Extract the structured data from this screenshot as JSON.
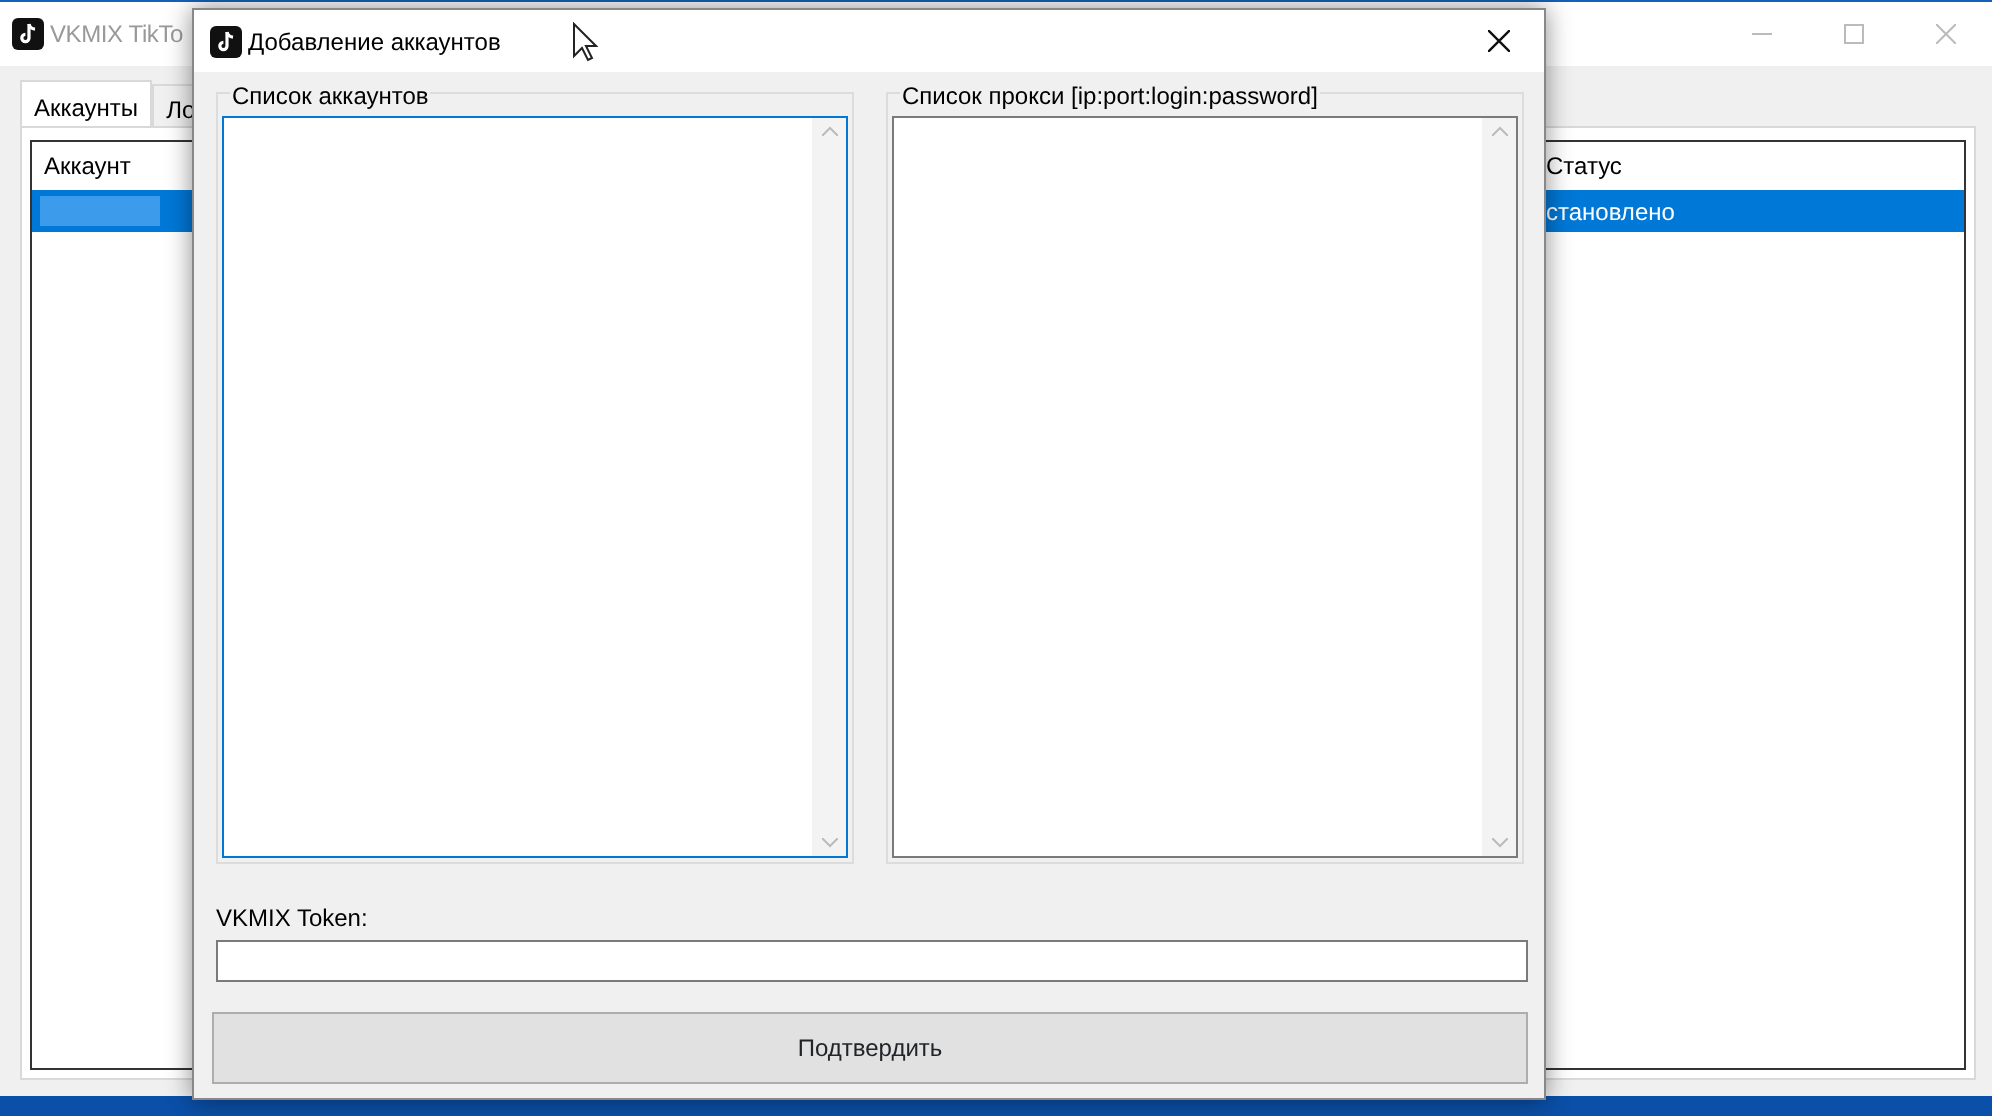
{
  "main_window": {
    "title": "VKMIX TikTo",
    "tabs": [
      {
        "label": "Аккаунты",
        "selected": true
      },
      {
        "label": "Ло",
        "selected": false
      }
    ],
    "table": {
      "columns": [
        "Аккаунт",
        "Статус"
      ],
      "rows": [
        {
          "status": "становлено",
          "selected": true
        }
      ]
    }
  },
  "dialog": {
    "title": "Добавление аккаунтов",
    "groups": [
      {
        "label": "Список аккаунтов",
        "focused": true
      },
      {
        "label": "Список прокси [ip:port:login:password]",
        "focused": false
      }
    ],
    "token_label": "VKMIX Token:",
    "submit": "Подтвердить"
  }
}
